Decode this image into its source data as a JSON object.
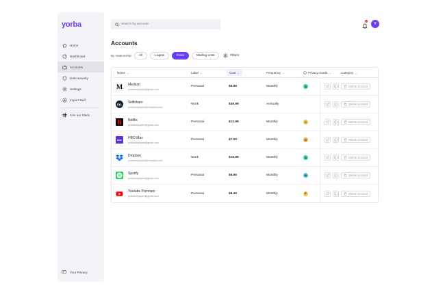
{
  "app": {
    "logo": "yorba"
  },
  "sidebar": {
    "items": [
      {
        "label": "Home",
        "icon": "home-icon",
        "active": false
      },
      {
        "label": "Dashboard",
        "icon": "dashboard-icon",
        "active": false
      },
      {
        "label": "Accounts",
        "icon": "accounts-icon",
        "active": true
      },
      {
        "label": "Data security",
        "icon": "shield-icon",
        "active": false
      },
      {
        "label": "Settings",
        "icon": "gear-icon",
        "active": false
      },
      {
        "label": "Import stuff",
        "icon": "import-icon",
        "active": false
      }
    ],
    "slack": {
      "label": "Join our Slack",
      "icon": "slack-icon"
    },
    "footer": {
      "label": "Your Privacy",
      "icon": "privacy-icon"
    }
  },
  "header": {
    "search_placeholder": "Search by account",
    "avatar_initial": "Y"
  },
  "page": {
    "title": "Accounts",
    "filter_label": "By relationship:",
    "chips": [
      "All",
      "Logins",
      "Fees",
      "Mailing Lists"
    ],
    "active_chip": "Fees",
    "filters_label": "Filters"
  },
  "table": {
    "columns": {
      "name": "Name",
      "label": "Label",
      "cost": "Cost",
      "frequency": "Frequency",
      "grade": "Privacy Grade",
      "category": "Category"
    },
    "delete_label": "Delete account",
    "rows": [
      {
        "name": "Medium",
        "email": "yorbaemployee@gmail.com",
        "label": "Personal",
        "cost": "$5.99",
        "frequency": "Monthly",
        "grade": "A",
        "grade_color": "#3fcf8e",
        "logo": "medium-logo"
      },
      {
        "name": "Skillshare",
        "email": "yorbaemployee@company.com",
        "label": "Work",
        "cost": "$49.99",
        "frequency": "Annually",
        "grade": "",
        "grade_color": "",
        "logo": "skillshare-logo"
      },
      {
        "name": "Netflix",
        "email": "yorbaemployee@gmail.com",
        "label": "Personal",
        "cost": "$12.99",
        "frequency": "Monthly",
        "grade": "C",
        "grade_color": "#f5c44a",
        "logo": "netflix-logo"
      },
      {
        "name": "HBO Max",
        "email": "yorbaemployee@gmail.com",
        "label": "Personal",
        "cost": "$7.00",
        "frequency": "Monthly",
        "grade": "D",
        "grade_color": "#f0b54a",
        "logo": "hbo-max-logo"
      },
      {
        "name": "Dropbox",
        "email": "yorbaemployee@company.com",
        "label": "Work",
        "cost": "$19.99",
        "frequency": "Monthly",
        "grade": "A",
        "grade_color": "#3fcf8e",
        "logo": "dropbox-logo"
      },
      {
        "name": "Spotify",
        "email": "yorbaemployee@gmail.com",
        "label": "Personal",
        "cost": "$9.96",
        "frequency": "Monthly",
        "grade": "B",
        "grade_color": "#4ec4d8",
        "logo": "spotify-logo"
      },
      {
        "name": "Youtube Premium",
        "email": "yorbaemployee@gmail.com",
        "label": "Personal",
        "cost": "$8.49",
        "frequency": "Monthly",
        "grade": "E",
        "grade_color": "#f5c44a",
        "logo": "youtube-logo"
      }
    ]
  },
  "colors": {
    "accent": "#6a3df0",
    "sidebar_bg": "#f4f4f8",
    "notification_dot": "#e5484d"
  }
}
